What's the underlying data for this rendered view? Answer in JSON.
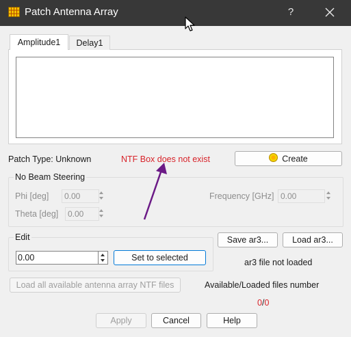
{
  "window": {
    "title": "Patch Antenna Array",
    "help_glyph": "?",
    "close_icon": "close-icon",
    "app_icon": "grid-app-icon"
  },
  "tabs": [
    {
      "label": "Amplitude1",
      "active": true
    },
    {
      "label": "Delay1",
      "active": false
    }
  ],
  "patch": {
    "type_text": "Patch Type: Unknown",
    "error_text": "NTF Box does not exist",
    "create_label": "Create"
  },
  "beam_steering": {
    "title": "No Beam Steering",
    "phi_label": "Phi [deg]",
    "phi_value": "0.00",
    "theta_label": "Theta [deg]",
    "theta_value": "0.00",
    "frequency_label": "Frequency [GHz]",
    "frequency_value": "0.00"
  },
  "edit": {
    "title": "Edit",
    "value": "0.00",
    "set_label": "Set to selected"
  },
  "ar3": {
    "save_label": "Save ar3...",
    "load_label": "Load ar3...",
    "status": "ar3 file not loaded"
  },
  "load_all_label": "Load all available antenna array NTF files",
  "files": {
    "label": "Available/Loaded files number",
    "available": "0",
    "separator": "/",
    "loaded": "0"
  },
  "footer": {
    "apply_label": "Apply",
    "cancel_label": "Cancel",
    "help_label": "Help"
  },
  "colors": {
    "titlebar": "#383838",
    "error_red": "#d8232a",
    "annotation_arrow": "#6b1a86",
    "focus_blue": "#0078d7"
  }
}
